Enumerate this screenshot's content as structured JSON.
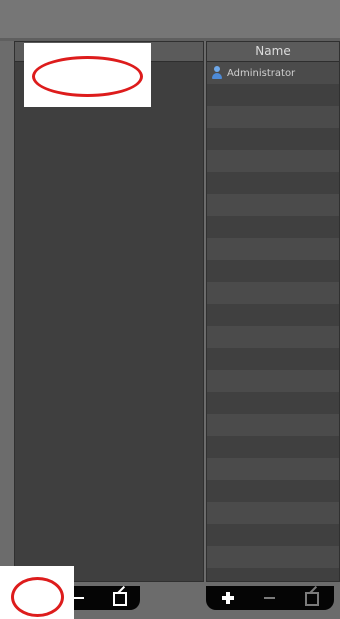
{
  "right_panel": {
    "header_label": "Name",
    "rows": [
      {
        "label": "Administrator",
        "icon": "user-icon"
      },
      {
        "label": ""
      },
      {
        "label": ""
      },
      {
        "label": ""
      },
      {
        "label": ""
      },
      {
        "label": ""
      },
      {
        "label": ""
      },
      {
        "label": ""
      },
      {
        "label": ""
      },
      {
        "label": ""
      },
      {
        "label": ""
      },
      {
        "label": ""
      },
      {
        "label": ""
      },
      {
        "label": ""
      },
      {
        "label": ""
      },
      {
        "label": ""
      },
      {
        "label": ""
      },
      {
        "label": ""
      },
      {
        "label": ""
      },
      {
        "label": ""
      },
      {
        "label": ""
      },
      {
        "label": ""
      },
      {
        "label": ""
      },
      {
        "label": ""
      }
    ]
  },
  "left_toolbar": {
    "buttons": [
      "remove",
      "edit"
    ]
  },
  "right_toolbar": {
    "buttons": [
      "add",
      "remove",
      "edit"
    ]
  },
  "colors": {
    "background": "#6c6c6c",
    "panel": "#3f3f3f",
    "row_odd": "#4b4b4b",
    "row_even": "#404040",
    "toolbar": "#050505",
    "annotation_red": "#dd1c1c",
    "user_icon_blue": "#6fa9ea"
  }
}
